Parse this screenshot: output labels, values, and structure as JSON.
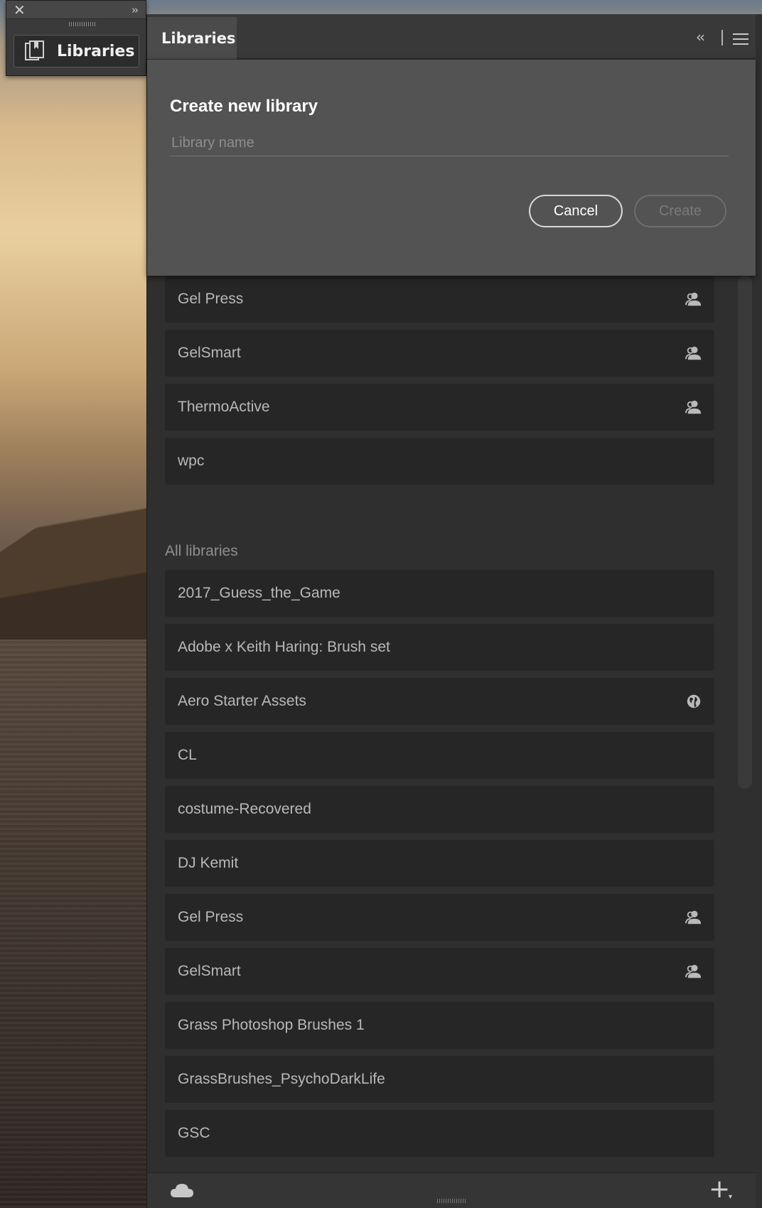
{
  "mini_panel": {
    "close_icon": "close-icon",
    "expand_icon": "double-chevron-right-icon",
    "button_label": "Libraries"
  },
  "tab": {
    "label": "Libraries",
    "collapse_icon": "double-chevron-left-icon",
    "menu_icon": "hamburger-menu-icon"
  },
  "dialog": {
    "title": "Create new library",
    "input_placeholder": "Library name",
    "input_value": "",
    "cancel_label": "Cancel",
    "create_label": "Create"
  },
  "recent_libraries": [
    {
      "name": "Gel Press",
      "icon": "shared-user-icon"
    },
    {
      "name": "GelSmart",
      "icon": "shared-user-icon"
    },
    {
      "name": "ThermoActive",
      "icon": "shared-user-icon"
    },
    {
      "name": "wpc",
      "icon": ""
    }
  ],
  "all_libraries_label": "All libraries",
  "all_libraries": [
    {
      "name": "2017_Guess_the_Game",
      "icon": ""
    },
    {
      "name": "Adobe x Keith Haring: Brush set",
      "icon": ""
    },
    {
      "name": "Aero Starter Assets",
      "icon": "public-globe-icon"
    },
    {
      "name": "CL",
      "icon": ""
    },
    {
      "name": "costume-Recovered",
      "icon": ""
    },
    {
      "name": "DJ Kemit",
      "icon": ""
    },
    {
      "name": "Gel Press",
      "icon": "shared-user-icon"
    },
    {
      "name": "GelSmart",
      "icon": "shared-user-icon"
    },
    {
      "name": "Grass Photoshop Brushes 1",
      "icon": ""
    },
    {
      "name": "GrassBrushes_PsychoDarkLife",
      "icon": ""
    },
    {
      "name": "GSC",
      "icon": ""
    }
  ],
  "footer": {
    "cloud_icon": "creative-cloud-icon",
    "add_icon": "add-plus-icon"
  },
  "colors": {
    "panel_bg": "#2f2f2f",
    "row_bg": "#262626",
    "dialog_bg": "#535353"
  }
}
